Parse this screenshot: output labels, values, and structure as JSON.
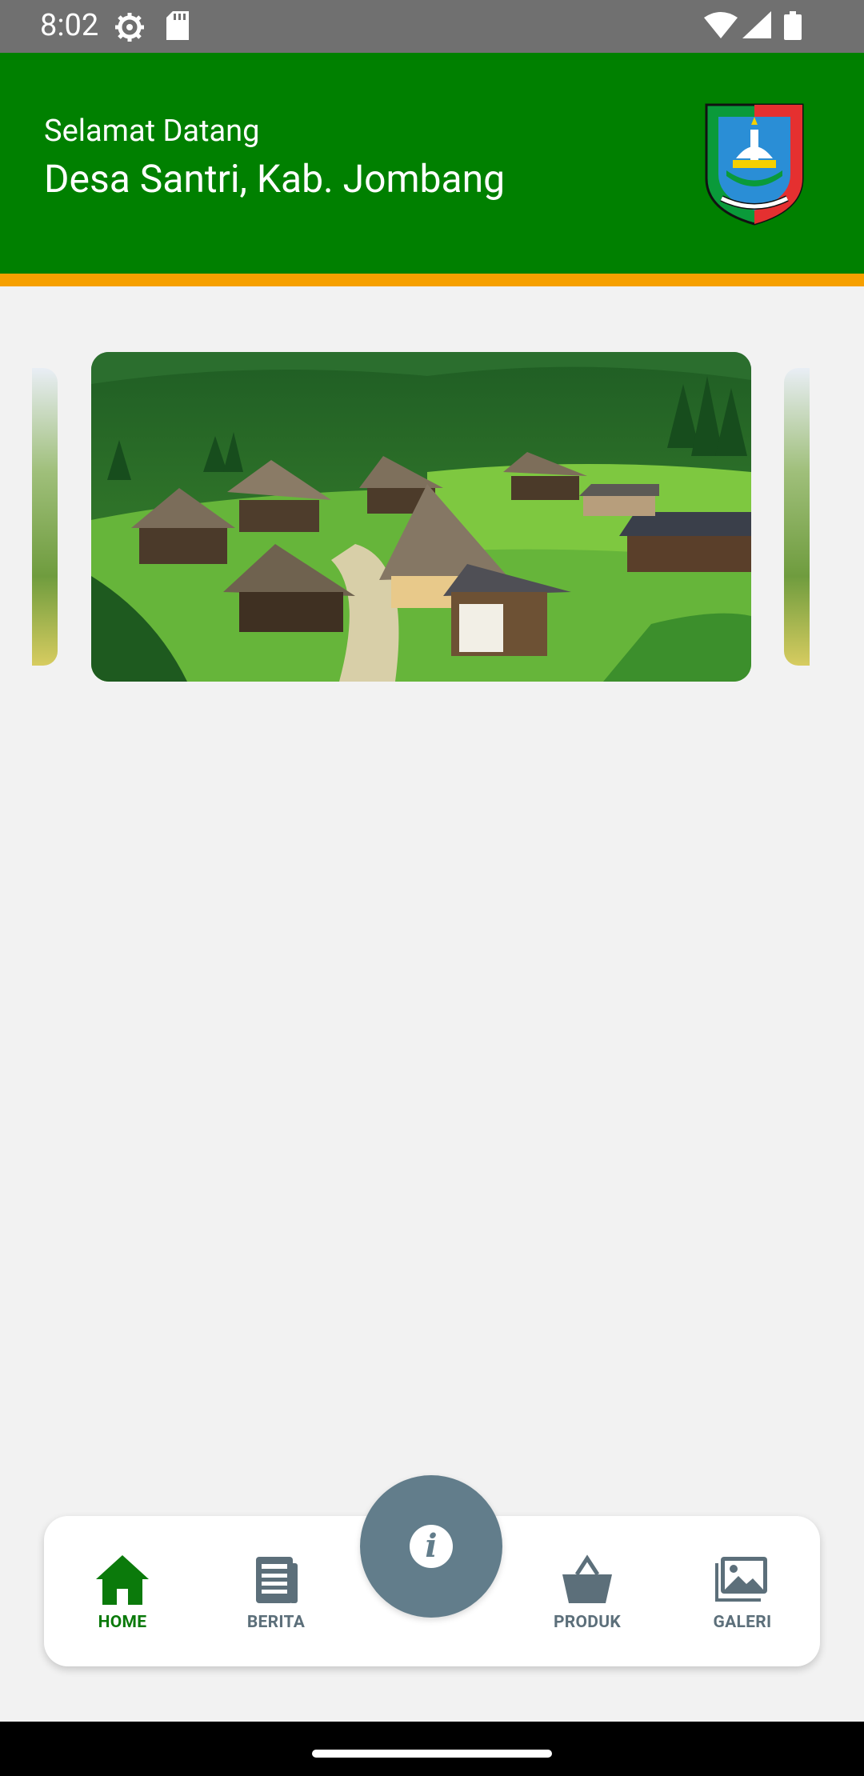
{
  "status_bar": {
    "time": "8:02",
    "icons": [
      "settings-icon",
      "sd-card-icon",
      "wifi-icon",
      "signal-icon",
      "battery-icon"
    ]
  },
  "header": {
    "greeting": "Selamat Datang",
    "village": "Desa Santri, Kab. Jombang",
    "background_color": "#008000",
    "stripe_color": "#f6a000",
    "logo_icon": "kabupaten-jombang-crest"
  },
  "carousel": {
    "images": [
      "village-landscape"
    ]
  },
  "bottom_nav": {
    "items": [
      {
        "label": "HOME",
        "icon": "home-icon",
        "active": true
      },
      {
        "label": "BERITA",
        "icon": "newspaper-icon",
        "active": false
      },
      {
        "label": "PRODUK",
        "icon": "basket-icon",
        "active": false
      },
      {
        "label": "GALERI",
        "icon": "gallery-icon",
        "active": false
      }
    ],
    "fab_icon": "info-icon",
    "fab_glyph": "i",
    "active_color": "#0b7a0b",
    "inactive_color": "#5c6f7a"
  }
}
